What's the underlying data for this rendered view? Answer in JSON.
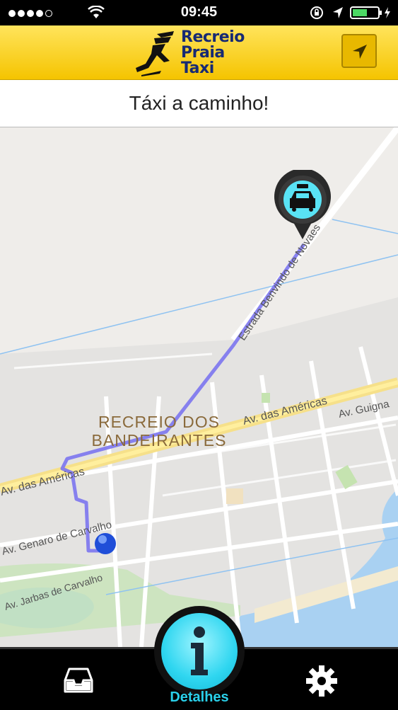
{
  "status_bar": {
    "time": "09:45"
  },
  "header": {
    "brand_line1": "Recreio",
    "brand_line2": "Praia",
    "brand_line3": "Taxi"
  },
  "banner": {
    "text": "Táxi a caminho!"
  },
  "map": {
    "neighborhood_line1": "RECREIO DOS",
    "neighborhood_line2": "BANDEIRANTES",
    "roads": {
      "estrada": "Estrada Benvindo de Novaes",
      "americas_right": "Av. das Américas",
      "americas_left": "Av. das Américas",
      "guignard": "Av. Guigna",
      "genaro": "Av. Genaro de Carvalho",
      "jarbas": "Av. Jarbas de Carvalho"
    }
  },
  "tab_bar": {
    "details_label": "Detalhes"
  },
  "colors": {
    "header_yellow": "#f5c400",
    "route": "#7b74f0",
    "accent_cyan": "#2ad0ea",
    "brand_blue": "#172a73"
  }
}
